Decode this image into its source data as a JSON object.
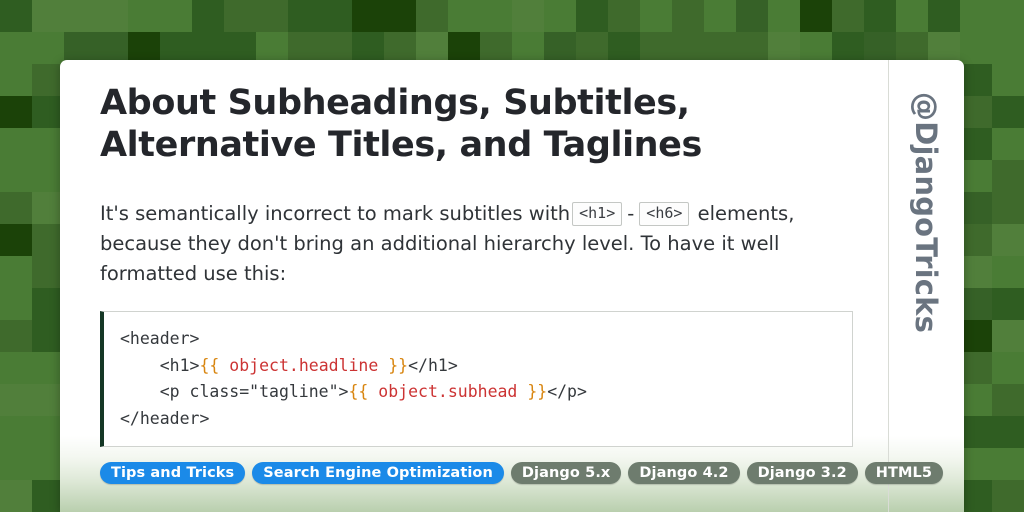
{
  "background": {
    "name": "green-checkerboard",
    "tile_size": 32,
    "colors": [
      "#4a7c35",
      "#3f6a2c",
      "#2f5d21",
      "#1b4208",
      "#517f3b",
      "#366127"
    ]
  },
  "card": {
    "title": "About Subheadings, Subtitles, Alternative Titles, and Taglines",
    "intro": {
      "part1": "It's semantically incorrect to mark subtitles with",
      "chip1": "<h1>",
      "separator": "-",
      "chip2": "<h6>",
      "part2": "elements, because they don't bring an additional hierarchy level. To have it well formatted use this:"
    },
    "code": {
      "language": "html",
      "lines": [
        {
          "segments": [
            {
              "text": "<header>",
              "type": "plain"
            }
          ]
        },
        {
          "segments": [
            {
              "text": "    <h1>",
              "type": "plain"
            },
            {
              "text": "{{",
              "type": "brace"
            },
            {
              "text": " object.headline ",
              "type": "var"
            },
            {
              "text": "}}",
              "type": "brace"
            },
            {
              "text": "</h1>",
              "type": "plain"
            }
          ]
        },
        {
          "segments": [
            {
              "text": "    <p class=\"tagline\">",
              "type": "plain"
            },
            {
              "text": "{{",
              "type": "brace"
            },
            {
              "text": " object.subhead ",
              "type": "var"
            },
            {
              "text": "}}",
              "type": "brace"
            },
            {
              "text": "</p>",
              "type": "plain"
            }
          ]
        },
        {
          "segments": [
            {
              "text": "</header>",
              "type": "plain"
            }
          ]
        }
      ],
      "accent_border_color": "#153725",
      "brace_color": "#d8850f",
      "variable_color": "#cc3333"
    },
    "tags": [
      {
        "label": "Tips and Tricks",
        "style": "primary"
      },
      {
        "label": "Search Engine Optimization",
        "style": "primary"
      },
      {
        "label": "Django 5.x",
        "style": "muted"
      },
      {
        "label": "Django 4.2",
        "style": "muted"
      },
      {
        "label": "Django 3.2",
        "style": "muted"
      },
      {
        "label": "HTML5",
        "style": "muted"
      }
    ],
    "tag_colors": {
      "primary": "#1b8ae8",
      "muted": "#6e7c6e"
    }
  },
  "sidebar": {
    "handle": "@DjangoTricks",
    "handle_color": "#6a7480"
  }
}
